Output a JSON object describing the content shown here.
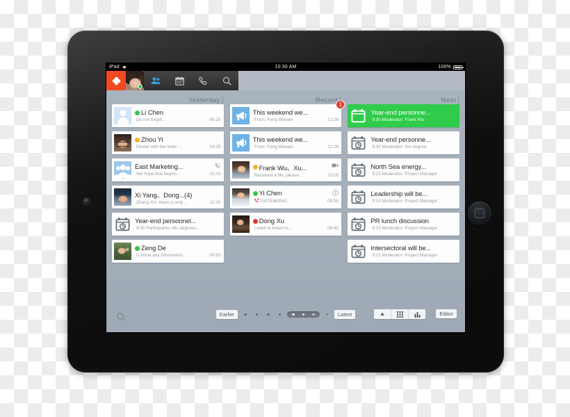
{
  "status_bar": {
    "device_label": "iPad",
    "wifi_icon": "wifi-icon",
    "time": "10:30 AM",
    "battery_percent": "100%"
  },
  "app_bar": {
    "brand_icon": "clover-logo-icon",
    "avatar_name": "user-avatar",
    "presence": "online",
    "items": [
      {
        "name": "contacts-icon",
        "label": "Contacts"
      },
      {
        "name": "calendar-icon",
        "label": "Calendar"
      },
      {
        "name": "phone-icon",
        "label": "Phone"
      },
      {
        "name": "search-icon",
        "label": "Search"
      }
    ]
  },
  "columns": [
    {
      "header": "Yesterday",
      "cards": [
        {
          "title": "Li Chen",
          "snippet": "Do not forget...",
          "time": "06:20",
          "presence": "online",
          "avatar": "av-generic",
          "corner_icon": "",
          "badge": ""
        },
        {
          "title": "Zhou Yi",
          "snippet": "Dinner with the letter ...",
          "time": "04:30",
          "presence": "away",
          "avatar": "ph-glasses",
          "corner_icon": "",
          "badge": ""
        },
        {
          "title": "East Marketing...",
          "snippet": "We hope that begins...",
          "time": "01:00",
          "presence": "",
          "avatar": "av-group",
          "corner_icon": "phone-icon",
          "badge": ""
        },
        {
          "title": "Xi Yang、Dong...(4)",
          "snippet": "Zhang Xin: there is only...",
          "time": "11:30",
          "presence": "",
          "avatar": "ph-cap",
          "corner_icon": "",
          "badge": ""
        },
        {
          "title": "Year-end personnel...",
          "snippet": "9:30 Participants: Wu degrees...",
          "time": "",
          "presence": "",
          "avatar": "cal-clock",
          "corner_icon": "",
          "badge": ""
        },
        {
          "title": "Zeng De",
          "snippet": "U know any information...",
          "time": "09:50",
          "presence": "online",
          "avatar": "ph-zeng",
          "corner_icon": "",
          "badge": ""
        }
      ]
    },
    {
      "header": "Recent",
      "cards": [
        {
          "title": "This weekend we...",
          "snippet": "From: Feng Weiwei",
          "time": "12:26",
          "presence": "",
          "avatar": "av-mega",
          "corner_icon": "",
          "badge": "1"
        },
        {
          "title": "This weekend we...",
          "snippet": "From: Feng Weiwei",
          "time": "12:26",
          "presence": "",
          "avatar": "av-mega",
          "corner_icon": "",
          "badge": ""
        },
        {
          "title": "Frank Wu、Xu...",
          "snippet": "Received a file, please...",
          "time": "10:05",
          "presence": "away",
          "avatar": "ph-frank",
          "corner_icon": "video-icon",
          "badge": ""
        },
        {
          "title": "Yi Chen",
          "snippet": "15076369542.",
          "time": "09:55",
          "presence": "online",
          "avatar": "ph-yichen",
          "corner_icon": "info-icon",
          "badge": "",
          "snippet_prefix_icon": "missed-call-icon"
        },
        {
          "title": "Dong Xu",
          "snippet": "I want to travel to...",
          "time": "09:45",
          "presence": "busy",
          "avatar": "ph-dong",
          "corner_icon": "",
          "badge": ""
        }
      ]
    },
    {
      "header": "Next",
      "cards": [
        {
          "title": "Year-end personne...",
          "snippet": "9:30 Moderator: Frank Wu",
          "time": "",
          "presence": "",
          "avatar": "cal-bolt",
          "corner_icon": "",
          "badge": "",
          "highlight": true
        },
        {
          "title": "Year-end personne...",
          "snippet": "9:30 Moderator: Wu degree",
          "time": "",
          "presence": "",
          "avatar": "cal-clock",
          "corner_icon": "",
          "badge": ""
        },
        {
          "title": "North Sea energy...",
          "snippet": "9:15 Moderator: Project Manager",
          "time": "",
          "presence": "",
          "avatar": "cal-clock",
          "corner_icon": "",
          "badge": ""
        },
        {
          "title": "Leadership will be...",
          "snippet": "9:15 Moderator: Project Manager",
          "time": "",
          "presence": "",
          "avatar": "cal-clock",
          "corner_icon": "",
          "badge": ""
        },
        {
          "title": "PR lunch discussion",
          "snippet": "9:15 Moderator: Project Manager",
          "time": "",
          "presence": "",
          "avatar": "cal-clock",
          "corner_icon": "",
          "badge": ""
        },
        {
          "title": "Intersectoral will be...",
          "snippet": "9:15 Moderator: Project Manager",
          "time": "",
          "presence": "",
          "avatar": "cal-clock",
          "corner_icon": "",
          "badge": ""
        }
      ]
    }
  ],
  "bottom_bar": {
    "settings_icon": "gear-icon",
    "earlier_label": "Earlier",
    "latest_label": "Latest",
    "editor_label": "Editor",
    "view_modes": [
      {
        "name": "sort-up-icon"
      },
      {
        "name": "grid-view-icon"
      },
      {
        "name": "chart-view-icon"
      }
    ]
  },
  "colors": {
    "brand": "#f04a23",
    "highlight": "#2ecc4a",
    "badge": "#e8392b",
    "board": "#a9b3be",
    "online": "#3cc24c",
    "away": "#f0b429",
    "busy": "#e0392b"
  }
}
